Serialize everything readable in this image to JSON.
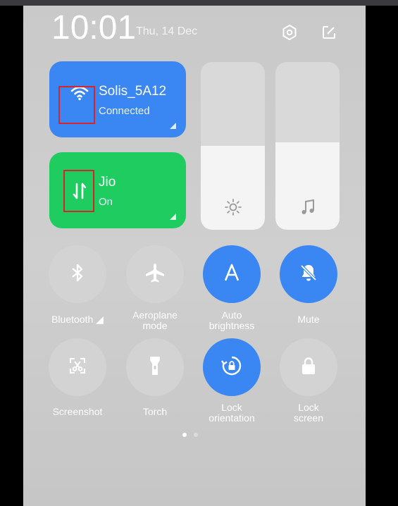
{
  "status": {
    "time": "10:01",
    "date": "Thu, 14 Dec"
  },
  "header_icons": [
    "settings-icon",
    "edit-icon"
  ],
  "tiles": {
    "wifi": {
      "title": "Solis_5A12",
      "subtitle": "Connected",
      "icon": "wifi-icon",
      "color": "#3a86f2"
    },
    "mobile_data": {
      "title": "Jio",
      "subtitle": "On",
      "icon": "mobile-data-icon",
      "color": "#1fcc5f"
    }
  },
  "sliders": {
    "brightness": {
      "icon": "brightness-icon",
      "level": 0.5
    },
    "volume": {
      "icon": "music-note-icon",
      "level": 0.52
    }
  },
  "toggles": [
    {
      "label_line1": "Bluetooth ◢",
      "label_line2": "",
      "icon": "bluetooth-icon",
      "state": "off"
    },
    {
      "label_line1": "Aeroplane",
      "label_line2": "mode",
      "icon": "airplane-icon",
      "state": "off"
    },
    {
      "label_line1": "Auto",
      "label_line2": "brightness",
      "icon": "auto-brightness-icon",
      "state": "on"
    },
    {
      "label_line1": "Mute",
      "label_line2": "",
      "icon": "mute-icon",
      "state": "on"
    },
    {
      "label_line1": "Screenshot",
      "label_line2": "",
      "icon": "screenshot-icon",
      "state": "off"
    },
    {
      "label_line1": "Torch",
      "label_line2": "",
      "icon": "torch-icon",
      "state": "off"
    },
    {
      "label_line1": "Lock",
      "label_line2": "orientation",
      "icon": "rotation-lock-icon",
      "state": "on"
    },
    {
      "label_line1": "Lock",
      "label_line2": "screen",
      "icon": "lock-icon",
      "state": "off"
    }
  ],
  "page_indicator": {
    "pages": 2,
    "current": 1
  },
  "colors": {
    "accent_blue": "#3a86f2",
    "accent_green": "#1fcc5f",
    "highlight_red": "#d8252c"
  }
}
